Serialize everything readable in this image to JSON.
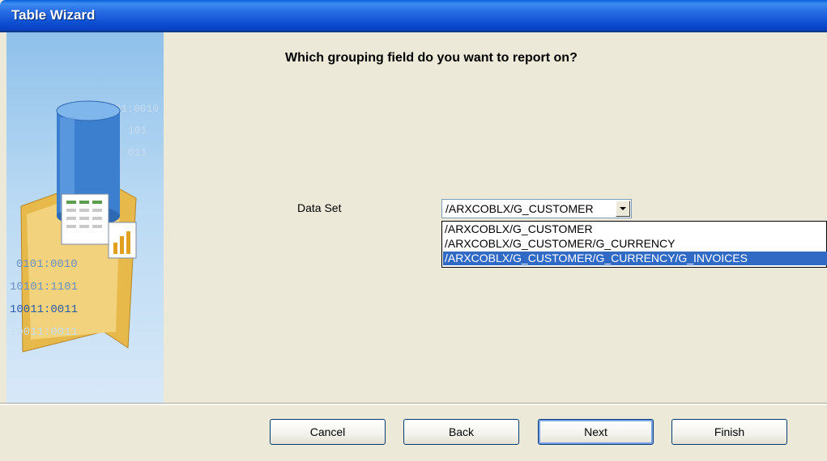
{
  "window": {
    "title": "Table Wizard"
  },
  "left_panel": {
    "binary_lines": [
      "0101:0010",
      "101",
      "011",
      "0101:0010",
      "10101:1101",
      "10011:0011",
      "10011:0011"
    ]
  },
  "main": {
    "heading": "Which grouping field do you want to report on?",
    "data_set_label": "Data Set",
    "data_set_selected": "/ARXCOBLX/G_CUSTOMER",
    "data_set_options": [
      "/ARXCOBLX/G_CUSTOMER",
      "/ARXCOBLX/G_CUSTOMER/G_CURRENCY",
      "/ARXCOBLX/G_CUSTOMER/G_CURRENCY/G_INVOICES"
    ],
    "highlighted_option_index": 2
  },
  "buttons": {
    "cancel": "Cancel",
    "back": "Back",
    "next": "Next",
    "finish": "Finish"
  },
  "colors": {
    "titlebar": "#0c4fd1",
    "selection": "#316ac5",
    "dialog_bg": "#ece9d8"
  }
}
